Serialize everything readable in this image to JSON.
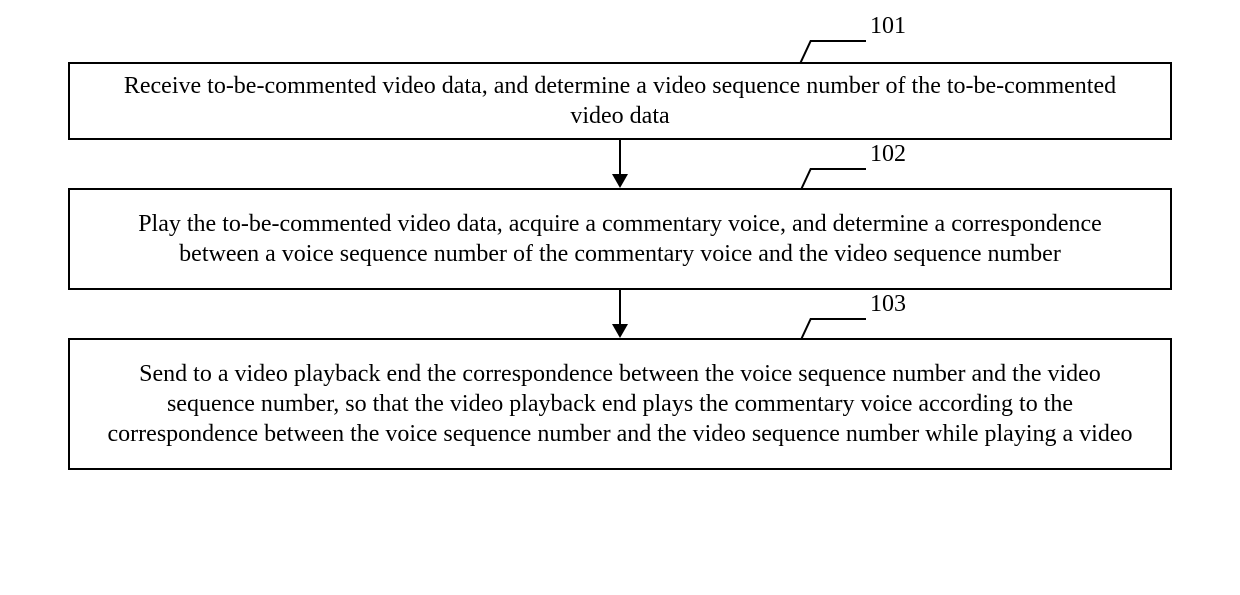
{
  "steps": [
    {
      "id": "101",
      "label": "101",
      "text": "Receive to-be-commented video data, and determine a video sequence number of the to-be-commented video data"
    },
    {
      "id": "102",
      "label": "102",
      "text": "Play the to-be-commented video data, acquire a commentary voice, and determine a correspondence between a voice sequence number of the commentary voice and the video sequence number"
    },
    {
      "id": "103",
      "label": "103",
      "text": "Send to a video playback end the correspondence between the voice sequence number and the video sequence number, so that the video playback end plays the commentary voice according to the correspondence between the voice sequence number and the video sequence number while playing a video"
    }
  ]
}
